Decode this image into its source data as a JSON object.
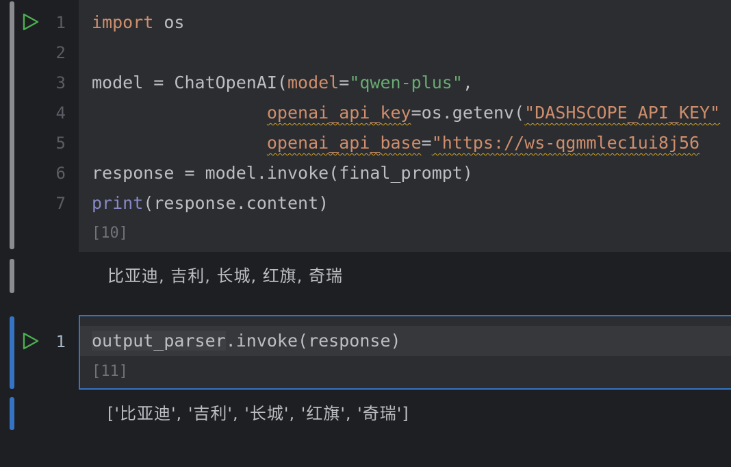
{
  "cell1": {
    "line_numbers": [
      "1",
      "2",
      "3",
      "4",
      "5",
      "6",
      "7"
    ],
    "code": {
      "l1_kw": "import",
      "l1_rest": " os",
      "l3_a": "model = ChatOpenAI(",
      "l3_param": "model",
      "l3_eq": "=",
      "l3_str": "\"qwen-plus\"",
      "l3_end": ",",
      "l4_indent": "                 ",
      "l4_param": "openai_api_key",
      "l4_eq": "=os.getenv(",
      "l4_str": "\"DASHSCOPE_API_KEY\"",
      "l5_indent": "                 ",
      "l5_param": "openai_api_base",
      "l5_eq": "=",
      "l5_str": "\"https://ws-qgmmlec1ui8j56",
      "l6": "response = model.invoke(final_prompt)",
      "l7_builtin": "print",
      "l7_rest": "(response.content)"
    },
    "exec_count": "[10]",
    "output": "比亚迪, 吉利, 长城, 红旗, 奇瑞"
  },
  "cell2": {
    "line_numbers": [
      "1"
    ],
    "code": {
      "l1_a": "output_parser",
      "l1_b": ".invoke(response)"
    },
    "exec_count": "[11]",
    "output": "['比亚迪', '吉利', '长城', '红旗', '奇瑞']"
  },
  "colors": {
    "background": "#1e1f22",
    "cell_background": "#2b2d30",
    "selected_border": "#3574c5",
    "run_icon": "#4caf50"
  }
}
